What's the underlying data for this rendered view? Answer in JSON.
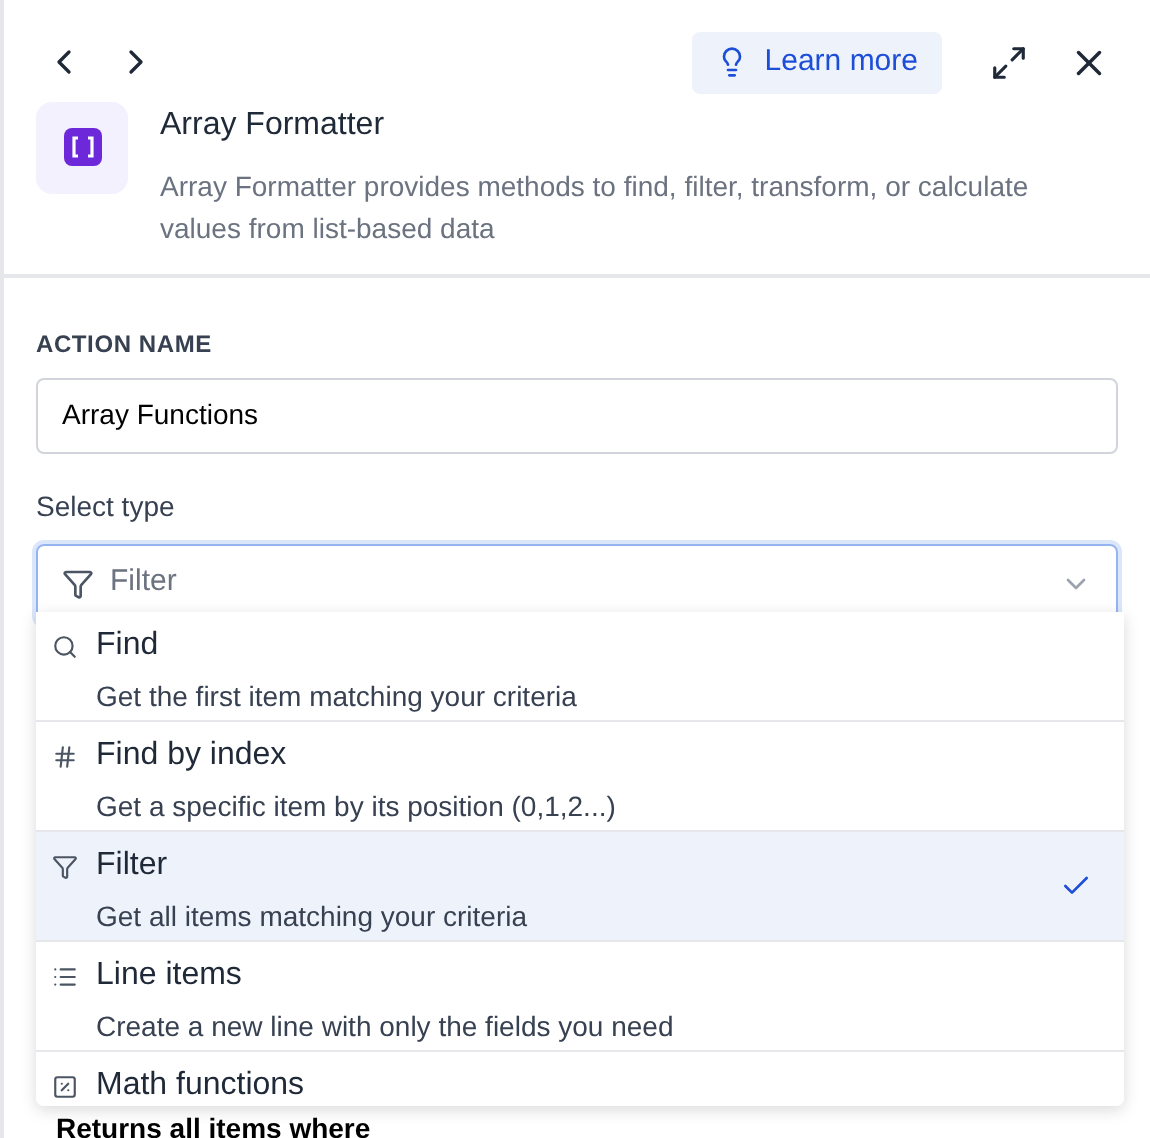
{
  "header": {
    "learn_more": "Learn more",
    "title": "Array Formatter",
    "description": "Array Formatter provides methods to find, filter, transform, or calculate values from list-based data"
  },
  "action_name": {
    "label": "ACTION NAME",
    "value": "Array Functions"
  },
  "select_type": {
    "label": "Select type",
    "value": "Filter",
    "kind": "filter",
    "expanded": true
  },
  "options": [
    {
      "kind": "search",
      "title": "Find",
      "description": "Get the first item matching your criteria",
      "selected": false
    },
    {
      "kind": "hash",
      "title": "Find by index",
      "description": "Get a specific item by its position (0,1,2...)",
      "selected": false
    },
    {
      "kind": "filter",
      "title": "Filter",
      "description": "Get all items matching your criteria",
      "selected": true
    },
    {
      "kind": "list",
      "title": "Line items",
      "description": "Create a new line with only the fields you need",
      "selected": false
    },
    {
      "kind": "percent",
      "title": "Math functions",
      "selected": false
    }
  ],
  "section_heading": "Returns all items where"
}
